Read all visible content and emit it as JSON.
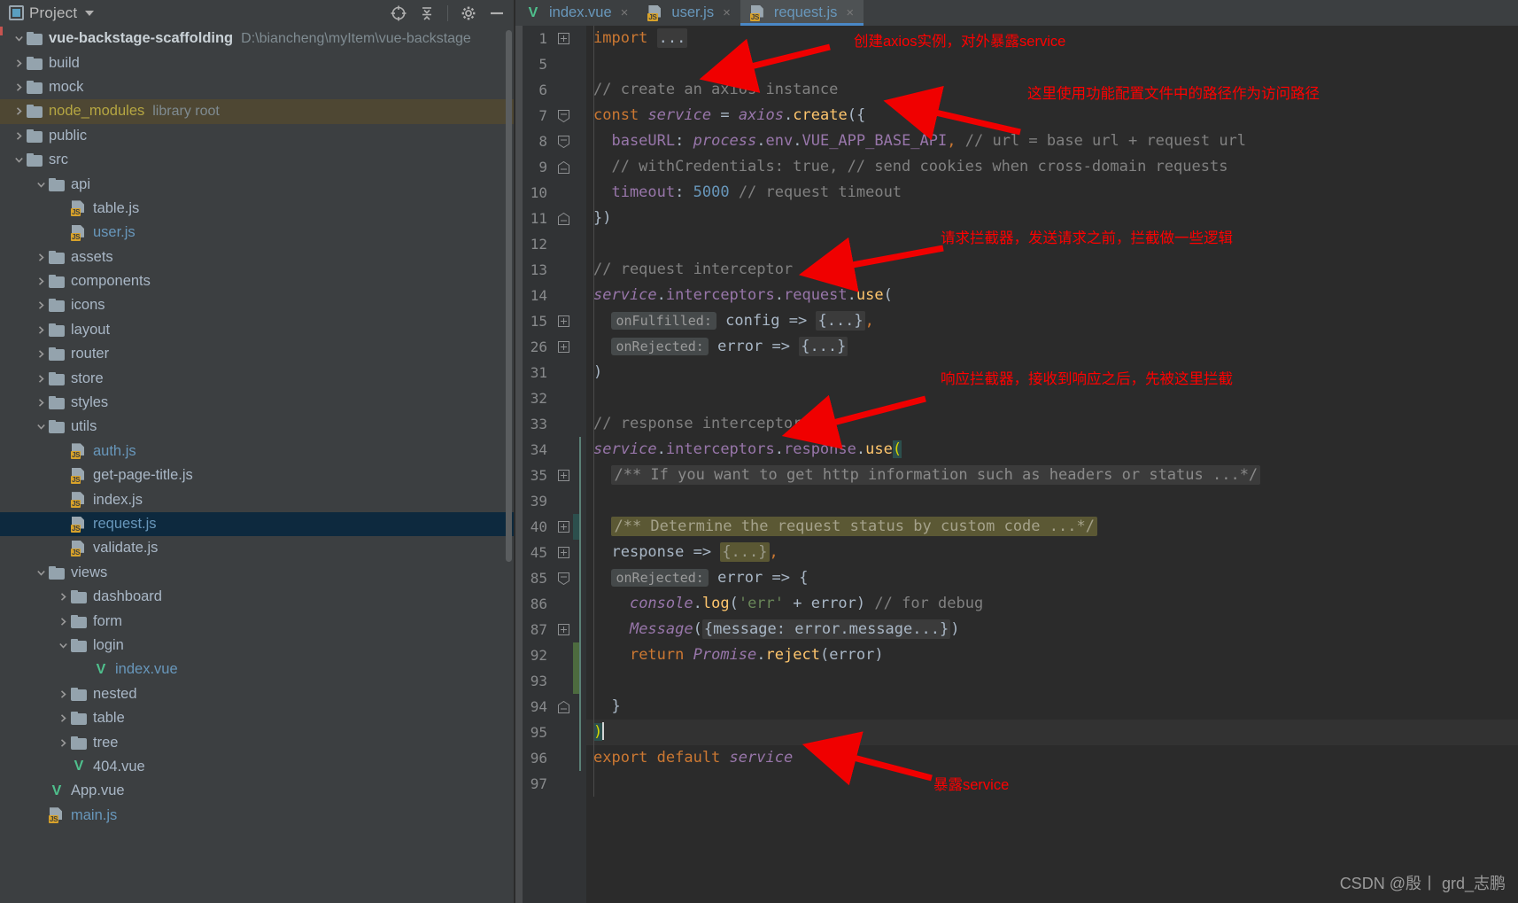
{
  "window": {
    "background": "#3c3f41",
    "editor_background": "#2b2b2b"
  },
  "project_panel": {
    "title": "Project",
    "icons": [
      {
        "name": "project-view-icon",
        "glyph": "▣"
      },
      {
        "name": "chevron-down-icon",
        "glyph": "▼"
      },
      {
        "name": "locate-target-icon",
        "glyph": "⊕"
      },
      {
        "name": "collapse-all-icon",
        "glyph": "≣"
      },
      {
        "name": "settings-gear-icon",
        "glyph": "⚙"
      },
      {
        "name": "minimize-icon",
        "glyph": "—"
      }
    ],
    "tree": [
      {
        "label": "vue-backstage-scaffolding",
        "suffix": "D:\\biancheng\\myItem\\vue-backstage",
        "depth": 0,
        "type": "root",
        "state": "expanded",
        "style": "root"
      },
      {
        "label": "build",
        "depth": 1,
        "type": "folder",
        "state": "collapsed"
      },
      {
        "label": "mock",
        "depth": 1,
        "type": "folder",
        "state": "collapsed"
      },
      {
        "label": "node_modules",
        "suffix": "library root",
        "depth": 1,
        "type": "folder",
        "state": "collapsed",
        "style": "yellow",
        "highlight": "library"
      },
      {
        "label": "public",
        "depth": 1,
        "type": "folder",
        "state": "collapsed"
      },
      {
        "label": "src",
        "depth": 1,
        "type": "folder",
        "state": "expanded"
      },
      {
        "label": "api",
        "depth": 2,
        "type": "folder",
        "state": "expanded"
      },
      {
        "label": "table.js",
        "depth": 3,
        "type": "js"
      },
      {
        "label": "user.js",
        "depth": 3,
        "type": "js",
        "style": "blue"
      },
      {
        "label": "assets",
        "depth": 2,
        "type": "folder",
        "state": "collapsed"
      },
      {
        "label": "components",
        "depth": 2,
        "type": "folder",
        "state": "collapsed"
      },
      {
        "label": "icons",
        "depth": 2,
        "type": "folder",
        "state": "collapsed"
      },
      {
        "label": "layout",
        "depth": 2,
        "type": "folder",
        "state": "collapsed"
      },
      {
        "label": "router",
        "depth": 2,
        "type": "folder",
        "state": "collapsed"
      },
      {
        "label": "store",
        "depth": 2,
        "type": "folder",
        "state": "collapsed"
      },
      {
        "label": "styles",
        "depth": 2,
        "type": "folder",
        "state": "collapsed"
      },
      {
        "label": "utils",
        "depth": 2,
        "type": "folder",
        "state": "expanded"
      },
      {
        "label": "auth.js",
        "depth": 3,
        "type": "js",
        "style": "blue"
      },
      {
        "label": "get-page-title.js",
        "depth": 3,
        "type": "js"
      },
      {
        "label": "index.js",
        "depth": 3,
        "type": "js"
      },
      {
        "label": "request.js",
        "depth": 3,
        "type": "js",
        "style": "blue",
        "highlight": "selected"
      },
      {
        "label": "validate.js",
        "depth": 3,
        "type": "js"
      },
      {
        "label": "views",
        "depth": 2,
        "type": "folder",
        "state": "expanded"
      },
      {
        "label": "dashboard",
        "depth": 3,
        "type": "folder",
        "state": "collapsed"
      },
      {
        "label": "form",
        "depth": 3,
        "type": "folder",
        "state": "collapsed"
      },
      {
        "label": "login",
        "depth": 3,
        "type": "folder",
        "state": "expanded"
      },
      {
        "label": "index.vue",
        "depth": 4,
        "type": "vue",
        "style": "blue"
      },
      {
        "label": "nested",
        "depth": 3,
        "type": "folder",
        "state": "collapsed"
      },
      {
        "label": "table",
        "depth": 3,
        "type": "folder",
        "state": "collapsed"
      },
      {
        "label": "tree",
        "depth": 3,
        "type": "folder",
        "state": "collapsed"
      },
      {
        "label": "404.vue",
        "depth": 3,
        "type": "vue"
      },
      {
        "label": "App.vue",
        "depth": 2,
        "type": "vue"
      },
      {
        "label": "main.js",
        "depth": 2,
        "type": "js",
        "style": "blue"
      }
    ]
  },
  "editor": {
    "tabs": [
      {
        "label": "index.vue",
        "type": "vue",
        "active": false,
        "close": "×"
      },
      {
        "label": "user.js",
        "type": "js",
        "active": false,
        "close": "×"
      },
      {
        "label": "request.js",
        "type": "js",
        "active": true,
        "close": "×"
      }
    ],
    "line_numbers": [
      1,
      5,
      6,
      7,
      8,
      9,
      10,
      11,
      12,
      13,
      14,
      15,
      26,
      31,
      32,
      33,
      34,
      35,
      39,
      40,
      45,
      85,
      86,
      87,
      92,
      93,
      94,
      95,
      96,
      97
    ],
    "current_line": 95,
    "code_lines": [
      {
        "n": 1,
        "text": "import ..."
      },
      {
        "n": 5,
        "text": ""
      },
      {
        "n": 6,
        "text": "// create an axios instance"
      },
      {
        "n": 7,
        "text": "const service = axios.create({"
      },
      {
        "n": 8,
        "text": "  baseURL: process.env.VUE_APP_BASE_API, // url = base url + request url"
      },
      {
        "n": 9,
        "text": "  // withCredentials: true, // send cookies when cross-domain requests"
      },
      {
        "n": 10,
        "text": "  timeout: 5000 // request timeout"
      },
      {
        "n": 11,
        "text": "})"
      },
      {
        "n": 12,
        "text": ""
      },
      {
        "n": 13,
        "text": "// request interceptor"
      },
      {
        "n": 14,
        "text": "service.interceptors.request.use("
      },
      {
        "n": 15,
        "text": "  onFulfilled: config => {...},"
      },
      {
        "n": 26,
        "text": "  onRejected: error => {...}"
      },
      {
        "n": 31,
        "text": ")"
      },
      {
        "n": 32,
        "text": ""
      },
      {
        "n": 33,
        "text": "// response interceptor"
      },
      {
        "n": 34,
        "text": "service.interceptors.response.use("
      },
      {
        "n": 35,
        "text": "  /** If you want to get http information such as headers or status ...*/"
      },
      {
        "n": 39,
        "text": ""
      },
      {
        "n": 40,
        "text": "  /** Determine the request status by custom code ...*/"
      },
      {
        "n": 45,
        "text": "  response => {...},"
      },
      {
        "n": 85,
        "text": "  onRejected: error => {"
      },
      {
        "n": 86,
        "text": "    console.log('err' + error) // for debug"
      },
      {
        "n": 87,
        "text": "    Message({message: error.message...})"
      },
      {
        "n": 92,
        "text": "    return Promise.reject(error)"
      },
      {
        "n": 93,
        "text": ""
      },
      {
        "n": 94,
        "text": "  }"
      },
      {
        "n": 95,
        "text": ")"
      },
      {
        "n": 96,
        "text": "export default service"
      },
      {
        "n": 97,
        "text": ""
      }
    ]
  },
  "annotations": [
    {
      "id": "a1",
      "text": "创建axios实例，对外暴露service",
      "color": "#ff0000"
    },
    {
      "id": "a2",
      "text": "这里使用功能配置文件中的路径作为访问路径",
      "color": "#ff0000"
    },
    {
      "id": "a3",
      "text": "请求拦截器，发送请求之前，拦截做一些逻辑",
      "color": "#ff0000"
    },
    {
      "id": "a4",
      "text": "响应拦截器，接收到响应之后，先被这里拦截",
      "color": "#ff0000"
    },
    {
      "id": "a5",
      "text": "暴露service",
      "color": "#ff0000"
    }
  ],
  "watermark": "CSDN @殷丨 grd_志鹏"
}
